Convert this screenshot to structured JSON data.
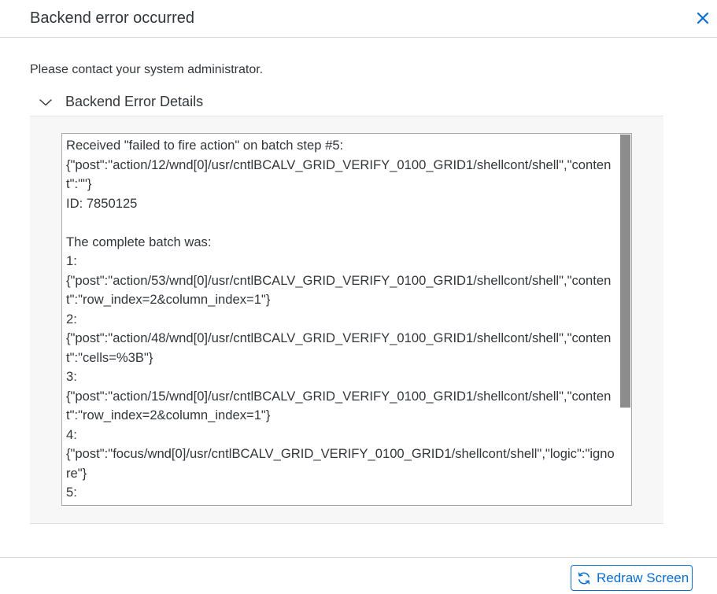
{
  "dialog": {
    "title": "Backend error occurred",
    "close_icon": "close-icon",
    "message": "Please contact your system administrator."
  },
  "details_panel": {
    "title": "Backend Error Details",
    "expanded": true,
    "chevron_icon": "chevron-down-icon",
    "content": "Received \"failed to fire action\" on batch step #5:\n{\"post\":\"action/12/wnd[0]/usr/cntlBCALV_GRID_VERIFY_0100_GRID1/shellcont/shell\",\"content\":\"\"}\nID: 7850125\n\nThe complete batch was:\n1:\n{\"post\":\"action/53/wnd[0]/usr/cntlBCALV_GRID_VERIFY_0100_GRID1/shellcont/shell\",\"content\":\"row_index=2&column_index=1\"}\n2:\n{\"post\":\"action/48/wnd[0]/usr/cntlBCALV_GRID_VERIFY_0100_GRID1/shellcont/shell\",\"content\":\"cells=%3B\"}\n3:\n{\"post\":\"action/15/wnd[0]/usr/cntlBCALV_GRID_VERIFY_0100_GRID1/shellcont/shell\",\"content\":\"row_index=2&column_index=1\"}\n4:\n{\"post\":\"focus/wnd[0]/usr/cntlBCALV_GRID_VERIFY_0100_GRID1/shellcont/shell\",\"logic\":\"ignore\"}\n5:"
  },
  "footer": {
    "redraw_label": "Redraw Screen",
    "redraw_icon": "refresh-icon"
  },
  "colors": {
    "accent": "#0a6ed1",
    "text": "#32363a",
    "panel_background": "#f7f7f7",
    "scrollbar_thumb": "#8c8c8c"
  }
}
